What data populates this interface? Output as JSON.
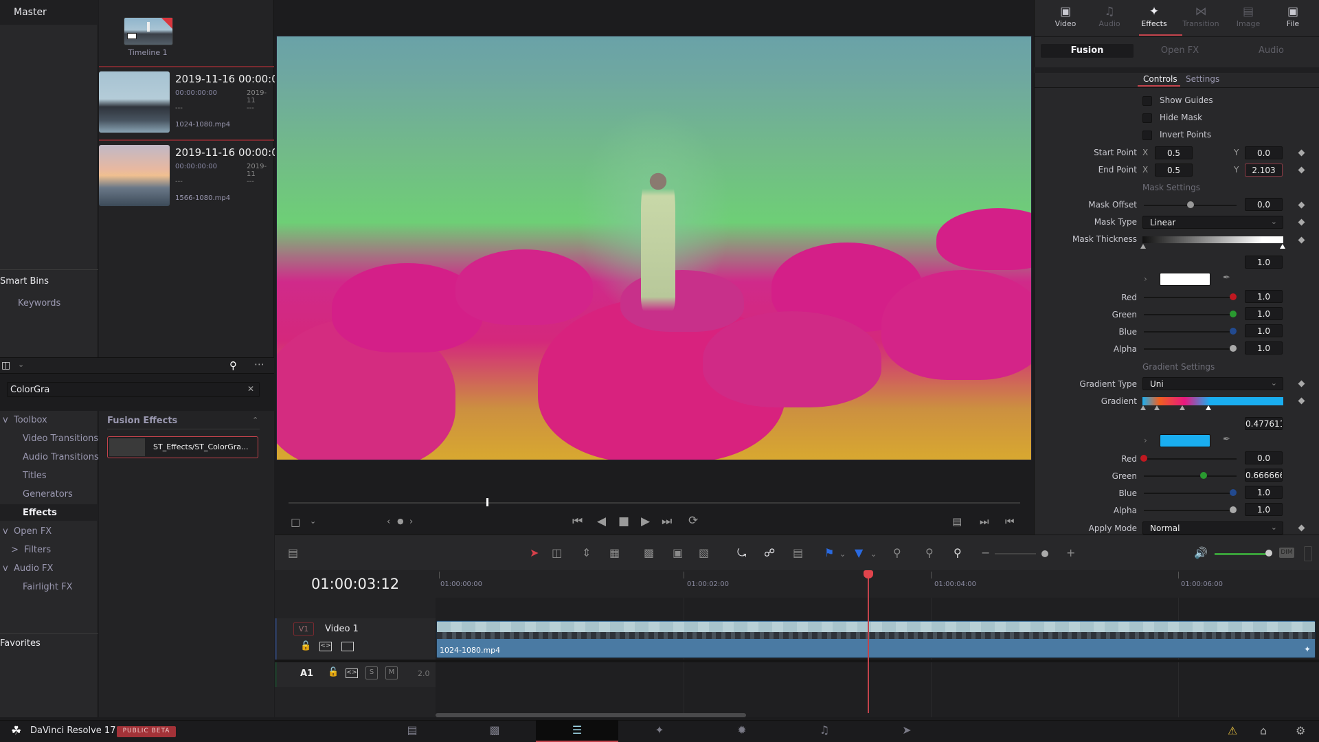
{
  "media_pool": {
    "bins": {
      "master": "Master",
      "smart_bins": "Smart Bins",
      "keywords": "Keywords",
      "favorites": "Favorites"
    },
    "timeline_item": {
      "name": "Timeline 1"
    },
    "clips": [
      {
        "date": "2019-11-16  00:00:0",
        "timecode": "00:00:00:00",
        "col2": "2019-11",
        "dash1": "---",
        "dash2": "---",
        "file": "1024-1080.mp4"
      },
      {
        "date": "2019-11-16  00:00:0",
        "timecode": "00:00:00:00",
        "col2": "2019-11",
        "dash1": "---",
        "dash2": "---",
        "file": "1566-1080.mp4"
      }
    ]
  },
  "effects_library": {
    "search_value": "ColorGra",
    "tree": [
      {
        "label": "Toolbox",
        "expander": "v"
      },
      {
        "label": "Video Transitions"
      },
      {
        "label": "Audio Transitions"
      },
      {
        "label": "Titles"
      },
      {
        "label": "Generators"
      },
      {
        "label": "Effects",
        "selected": true
      },
      {
        "label": "Open FX",
        "expander": "v"
      },
      {
        "label": "Filters",
        "expander": ">"
      },
      {
        "label": "Audio FX",
        "expander": "v"
      },
      {
        "label": "Fairlight FX"
      }
    ],
    "section_title": "Fusion Effects",
    "result": "ST_Effects/ST_ColorGra..."
  },
  "viewer": {
    "scrub_position": 0.27
  },
  "inspector": {
    "tabs": [
      {
        "label": "Video",
        "icon": "video-icon"
      },
      {
        "label": "Audio",
        "icon": "audio-icon"
      },
      {
        "label": "Effects",
        "icon": "effects-wand-icon",
        "active": true
      },
      {
        "label": "Transition",
        "icon": "transition-icon"
      },
      {
        "label": "Image",
        "icon": "image-icon"
      },
      {
        "label": "File",
        "icon": "file-camera-icon"
      }
    ],
    "subtabs": [
      "Fusion",
      "Open FX",
      "Audio"
    ],
    "control_tabs": [
      "Controls",
      "Settings"
    ],
    "checkboxes": [
      "Show Guides",
      "Hide Mask",
      "Invert Points"
    ],
    "start_point": {
      "label": "Start Point",
      "x": "0.5",
      "y": "0.0"
    },
    "end_point": {
      "label": "End Point",
      "x": "0.5",
      "y": "2.103"
    },
    "axis_x": "X",
    "axis_y": "Y",
    "mask_settings": "Mask Settings",
    "mask_offset": {
      "label": "Mask Offset",
      "value": "0.0"
    },
    "mask_type": {
      "label": "Mask Type",
      "value": "Linear"
    },
    "mask_thickness": {
      "label": "Mask Thickness",
      "value": "1.0"
    },
    "color1": {
      "hex": "#ffffff",
      "red": "1.0",
      "green": "1.0",
      "blue": "1.0",
      "alpha": "1.0"
    },
    "channel_labels": {
      "red": "Red",
      "green": "Green",
      "blue": "Blue",
      "alpha": "Alpha"
    },
    "gradient_settings": "Gradient Settings",
    "gradient_type": {
      "label": "Gradient Type",
      "value": "Uni"
    },
    "gradient": {
      "label": "Gradient",
      "stop_position": "0.477611",
      "colors": [
        "#1aaef0",
        "#f06020",
        "#e81880",
        "#1aaef0"
      ]
    },
    "color2": {
      "hex": "#1aaef0",
      "red": "0.0",
      "green": "0.666666",
      "blue": "1.0",
      "alpha": "1.0"
    },
    "apply_mode": {
      "label": "Apply Mode",
      "value": "Normal"
    }
  },
  "timeline": {
    "timecode": "01:00:03:12",
    "ruler": [
      "01:00:00:00",
      "01:00:02:00",
      "01:00:04:00",
      "01:00:06:00"
    ],
    "tracks": {
      "v1": {
        "badge": "V1",
        "name": "Video 1",
        "clip": "1024-1080.mp4"
      },
      "a1": {
        "badge": "A1",
        "solo": "S",
        "mute": "M",
        "channels": "2.0"
      }
    },
    "audio_dim": "DIM"
  },
  "bottom_bar": {
    "app_name": "DaVinci Resolve 17",
    "badge": "PUBLIC BETA",
    "pages": [
      "Media",
      "Cut",
      "Edit",
      "Fusion",
      "Color",
      "Fairlight",
      "Deliver"
    ],
    "active_page": "Edit"
  }
}
